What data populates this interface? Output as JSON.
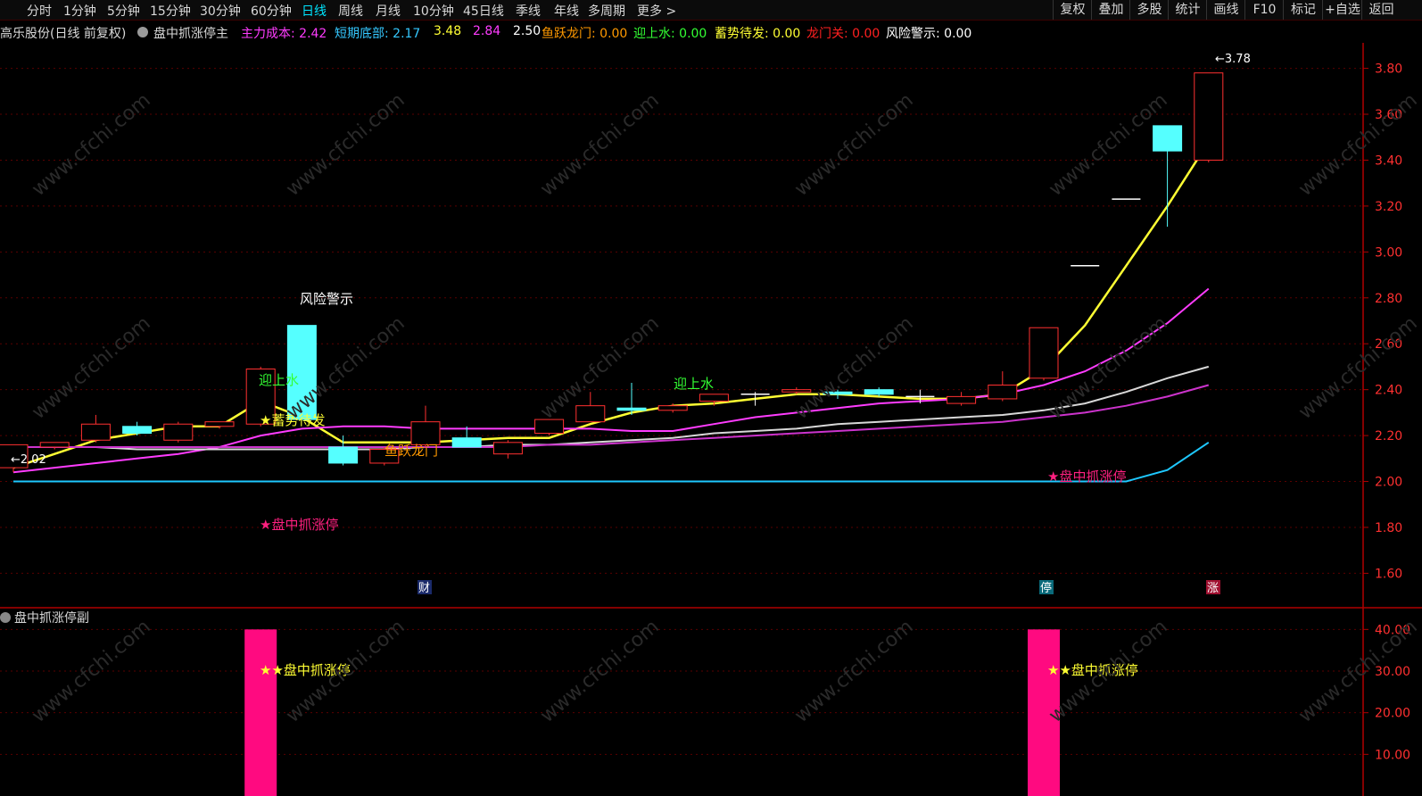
{
  "toolbar": {
    "periods": [
      "分时",
      "1分钟",
      "5分钟",
      "15分钟",
      "30分钟",
      "60分钟",
      "日线",
      "周线",
      "月线",
      "10分钟",
      "45日线",
      "季线",
      "年线",
      "多周期",
      "更多 >"
    ],
    "active": "日线",
    "right_buttons": [
      "复权",
      "叠加",
      "多股",
      "统计",
      "画线",
      "F10",
      "标记",
      "+自选",
      "返回"
    ]
  },
  "infobar": {
    "stock": "高乐股份(日线 前复权)",
    "indicator": "盘中抓涨停主",
    "items": [
      {
        "label": "主力成本:",
        "value": "2.42",
        "color": "#ff3cff"
      },
      {
        "label": "短期底部:",
        "value": "2.17",
        "color": "#35c8ff"
      },
      {
        "label": "",
        "value": "3.48",
        "color": "#ffff33"
      },
      {
        "label": "",
        "value": "2.84",
        "color": "#ff3cff"
      },
      {
        "label": "",
        "value": "2.50",
        "color": "#ffffff"
      },
      {
        "label": "鱼跃龙门:",
        "value": "0.00",
        "color": "#ff9900"
      },
      {
        "label": "迎上水:",
        "value": "0.00",
        "color": "#33ff33"
      },
      {
        "label": "蓄势待发:",
        "value": "0.00",
        "color": "#ffff33"
      },
      {
        "label": "龙门关:",
        "value": "0.00",
        "color": "#ff2020"
      },
      {
        "label": "风险警示:",
        "value": "0.00",
        "color": "#ffffff"
      }
    ]
  },
  "main_axis": {
    "ticks": [
      "3.80",
      "3.60",
      "3.40",
      "3.20",
      "3.00",
      "2.80",
      "2.60",
      "2.40",
      "2.20",
      "2.00",
      "1.80",
      "1.60"
    ]
  },
  "sub_panel": {
    "title": "盘中抓涨停副",
    "ticks": [
      "40.00",
      "30.00",
      "20.00",
      "10.00"
    ]
  },
  "annotations": {
    "risk": "风险警示",
    "up_water_1": "迎上水",
    "up_water_2": "迎上水",
    "accumulate": "★蓄势待发",
    "fish_jump": "鱼跃龙门",
    "limit_up_1": "★盘中抓涨停",
    "limit_up_2": "★盘中抓涨停",
    "sub_label_1": "★★盘中抓涨停",
    "sub_label_2": "★★盘中抓涨停",
    "low_marker": "←2.02",
    "high_marker": "←3.78"
  },
  "markers": {
    "cai": "财",
    "ting": "停",
    "zhang": "涨"
  },
  "watermark": "www.cfchi.com",
  "chart_data": {
    "type": "candlestick",
    "ylim": [
      1.45,
      3.88
    ],
    "candles": [
      {
        "o": 2.06,
        "h": 2.16,
        "l": 2.04,
        "c": 2.16
      },
      {
        "o": 2.15,
        "h": 2.17,
        "l": 2.14,
        "c": 2.17
      },
      {
        "o": 2.18,
        "h": 2.29,
        "l": 2.17,
        "c": 2.25
      },
      {
        "o": 2.24,
        "h": 2.26,
        "l": 2.2,
        "c": 2.21
      },
      {
        "o": 2.18,
        "h": 2.26,
        "l": 2.17,
        "c": 2.25
      },
      {
        "o": 2.24,
        "h": 2.26,
        "l": 2.23,
        "c": 2.26
      },
      {
        "o": 2.25,
        "h": 2.5,
        "l": 2.24,
        "c": 2.49
      },
      {
        "o": 2.68,
        "h": 2.68,
        "l": 2.27,
        "c": 2.27
      },
      {
        "o": 2.15,
        "h": 2.2,
        "l": 2.07,
        "c": 2.08
      },
      {
        "o": 2.08,
        "h": 2.15,
        "l": 2.07,
        "c": 2.14
      },
      {
        "o": 2.16,
        "h": 2.33,
        "l": 2.15,
        "c": 2.26
      },
      {
        "o": 2.19,
        "h": 2.24,
        "l": 2.15,
        "c": 2.15
      },
      {
        "o": 2.12,
        "h": 2.18,
        "l": 2.1,
        "c": 2.17
      },
      {
        "o": 2.21,
        "h": 2.27,
        "l": 2.2,
        "c": 2.27
      },
      {
        "o": 2.26,
        "h": 2.39,
        "l": 2.26,
        "c": 2.33
      },
      {
        "o": 2.32,
        "h": 2.43,
        "l": 2.29,
        "c": 2.31
      },
      {
        "o": 2.31,
        "h": 2.34,
        "l": 2.3,
        "c": 2.33
      },
      {
        "o": 2.35,
        "h": 2.38,
        "l": 2.33,
        "c": 2.38
      },
      {
        "o": 2.38,
        "h": 2.39,
        "l": 2.33,
        "c": 2.38
      },
      {
        "o": 2.39,
        "h": 2.41,
        "l": 2.38,
        "c": 2.4
      },
      {
        "o": 2.39,
        "h": 2.4,
        "l": 2.36,
        "c": 2.38
      },
      {
        "o": 2.4,
        "h": 2.41,
        "l": 2.37,
        "c": 2.38
      },
      {
        "o": 2.37,
        "h": 2.4,
        "l": 2.34,
        "c": 2.37
      },
      {
        "o": 2.34,
        "h": 2.39,
        "l": 2.33,
        "c": 2.37
      },
      {
        "o": 2.36,
        "h": 2.48,
        "l": 2.35,
        "c": 2.42
      },
      {
        "o": 2.45,
        "h": 2.67,
        "l": 2.44,
        "c": 2.67
      },
      {
        "o": 2.94,
        "h": 2.94,
        "l": 2.94,
        "c": 2.94
      },
      {
        "o": 3.23,
        "h": 3.23,
        "l": 3.23,
        "c": 3.23
      },
      {
        "o": 3.55,
        "h": 3.55,
        "l": 3.11,
        "c": 3.44
      },
      {
        "o": 3.4,
        "h": 3.78,
        "l": 3.39,
        "c": 3.78
      }
    ],
    "series": [
      {
        "color": "#ffff33",
        "values": [
          2.06,
          2.12,
          2.18,
          2.21,
          2.24,
          2.24,
          2.35,
          2.28,
          2.17,
          2.17,
          2.17,
          2.18,
          2.19,
          2.19,
          2.25,
          2.3,
          2.33,
          2.34,
          2.36,
          2.38,
          2.38,
          2.37,
          2.36,
          2.36,
          2.38,
          2.49,
          2.68,
          2.94,
          3.2,
          3.48
        ]
      },
      {
        "color": "#ff3cff",
        "values": [
          2.04,
          2.06,
          2.08,
          2.1,
          2.12,
          2.15,
          2.2,
          2.23,
          2.24,
          2.24,
          2.23,
          2.23,
          2.23,
          2.23,
          2.23,
          2.22,
          2.22,
          2.25,
          2.28,
          2.3,
          2.32,
          2.34,
          2.35,
          2.36,
          2.38,
          2.42,
          2.48,
          2.57,
          2.69,
          2.84
        ]
      },
      {
        "color": "#d8d8d8",
        "values": [
          2.15,
          2.15,
          2.15,
          2.14,
          2.14,
          2.14,
          2.14,
          2.14,
          2.14,
          2.14,
          2.15,
          2.15,
          2.16,
          2.16,
          2.17,
          2.18,
          2.19,
          2.21,
          2.22,
          2.23,
          2.25,
          2.26,
          2.27,
          2.28,
          2.29,
          2.31,
          2.34,
          2.39,
          2.45,
          2.5
        ]
      },
      {
        "color": "#cc33cc",
        "values": [
          2.15,
          2.15,
          2.15,
          2.15,
          2.15,
          2.15,
          2.15,
          2.15,
          2.15,
          2.15,
          2.15,
          2.15,
          2.15,
          2.16,
          2.16,
          2.17,
          2.18,
          2.19,
          2.2,
          2.21,
          2.22,
          2.23,
          2.24,
          2.25,
          2.26,
          2.28,
          2.3,
          2.33,
          2.37,
          2.42
        ]
      },
      {
        "color": "#1ec8ff",
        "values": [
          2.0,
          2.0,
          2.0,
          2.0,
          2.0,
          2.0,
          2.0,
          2.0,
          2.0,
          2.0,
          2.0,
          2.0,
          2.0,
          2.0,
          2.0,
          2.0,
          2.0,
          2.0,
          2.0,
          2.0,
          2.0,
          2.0,
          2.0,
          2.0,
          2.0,
          2.0,
          2.0,
          2.0,
          2.05,
          2.17
        ]
      }
    ],
    "sub": {
      "ylim": [
        0,
        45
      ],
      "bars": [
        {
          "index": 6,
          "value": 40
        },
        {
          "index": 25,
          "value": 40
        }
      ]
    }
  }
}
